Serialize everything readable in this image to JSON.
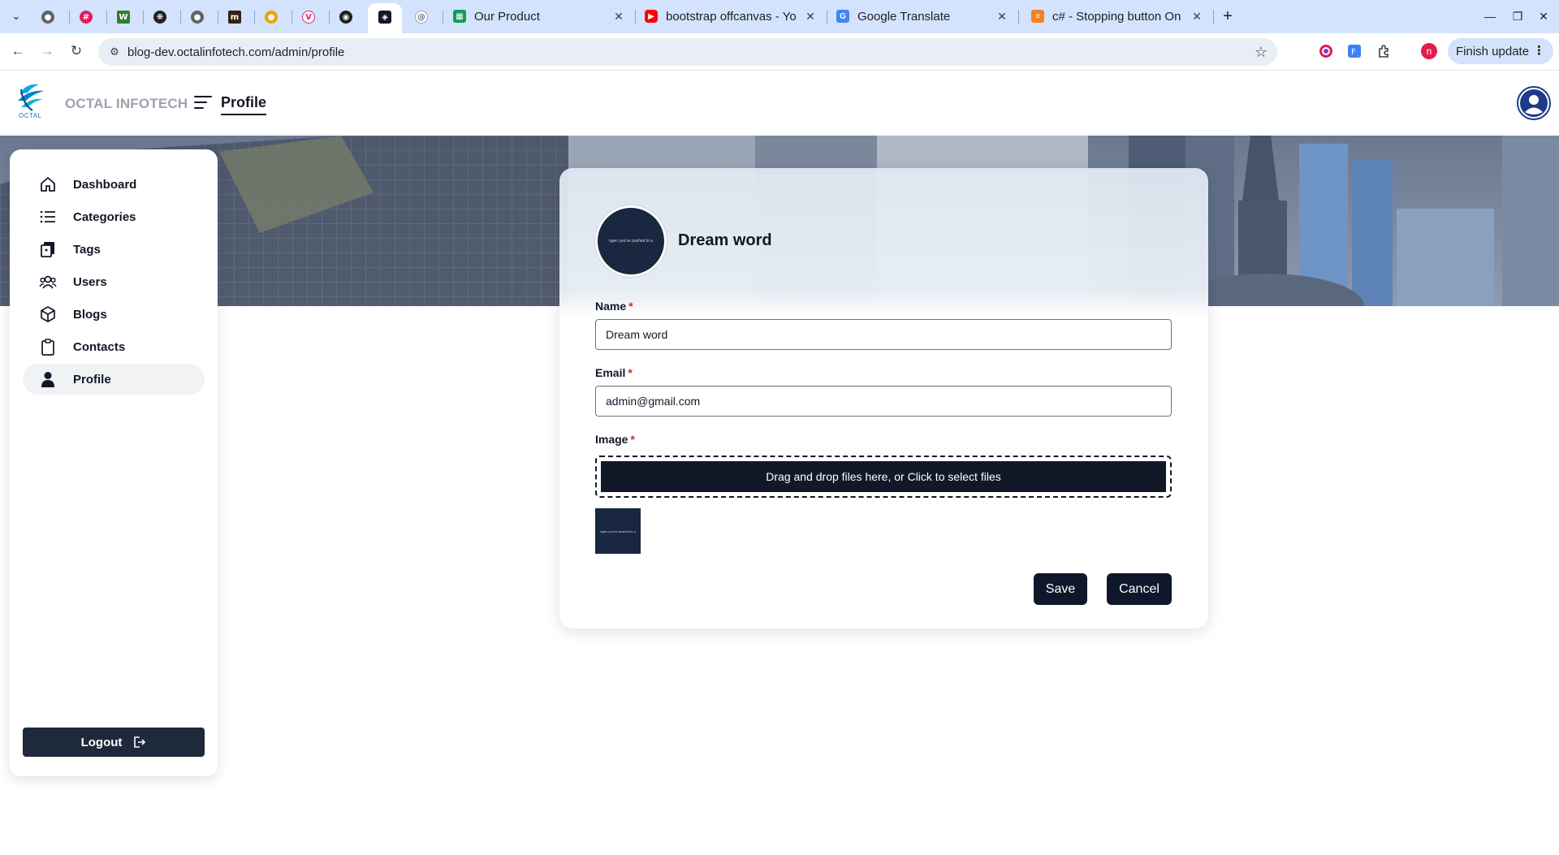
{
  "browser": {
    "tabs": [
      {
        "title": "Our Product",
        "favicon": "sheets-icon",
        "color": "#0f9d58"
      },
      {
        "title": "bootstrap offcanvas - Yo",
        "favicon": "youtube-icon",
        "color": "#ff0000"
      },
      {
        "title": "Google Translate",
        "favicon": "translate-icon",
        "color": "#4285f4"
      },
      {
        "title": "c# - Stopping button On",
        "favicon": "stackoverflow-icon",
        "color": "#f48024"
      }
    ],
    "url": "blog-dev.octalinfotech.com/admin/profile",
    "finish_update_label": "Finish update",
    "profile_initial": "n",
    "new_tab_symbol": "+"
  },
  "app": {
    "logo_text": "OCTAL",
    "brand": "OCTAL INFOTECH",
    "page_title": "Profile"
  },
  "sidebar": {
    "items": [
      {
        "label": "Dashboard",
        "icon": "home-icon"
      },
      {
        "label": "Categories",
        "icon": "list-icon"
      },
      {
        "label": "Tags",
        "icon": "tags-icon"
      },
      {
        "label": "Users",
        "icon": "users-icon"
      },
      {
        "label": "Blogs",
        "icon": "cube-icon"
      },
      {
        "label": "Contacts",
        "icon": "clipboard-icon"
      },
      {
        "label": "Profile",
        "icon": "user-icon",
        "active": true
      }
    ],
    "logout_label": "Logout"
  },
  "profile": {
    "display_name": "Dream word",
    "avatar_text": "ngen you've pushed to a",
    "name_label": "Name",
    "name_value": "Dream word",
    "email_label": "Email",
    "email_value": "admin@gmail.com",
    "image_label": "Image",
    "required_mark": "*",
    "dropzone_text": "Drag and drop files here, or Click to select files",
    "thumb_text": "ngen you've pushed to a",
    "save_label": "Save",
    "cancel_label": "Cancel"
  },
  "colors": {
    "primary_dark": "#0f172a",
    "sidebar_active": "#f1f2f4",
    "required": "#dc2626",
    "browser_tabbar": "#d3e3fd"
  }
}
